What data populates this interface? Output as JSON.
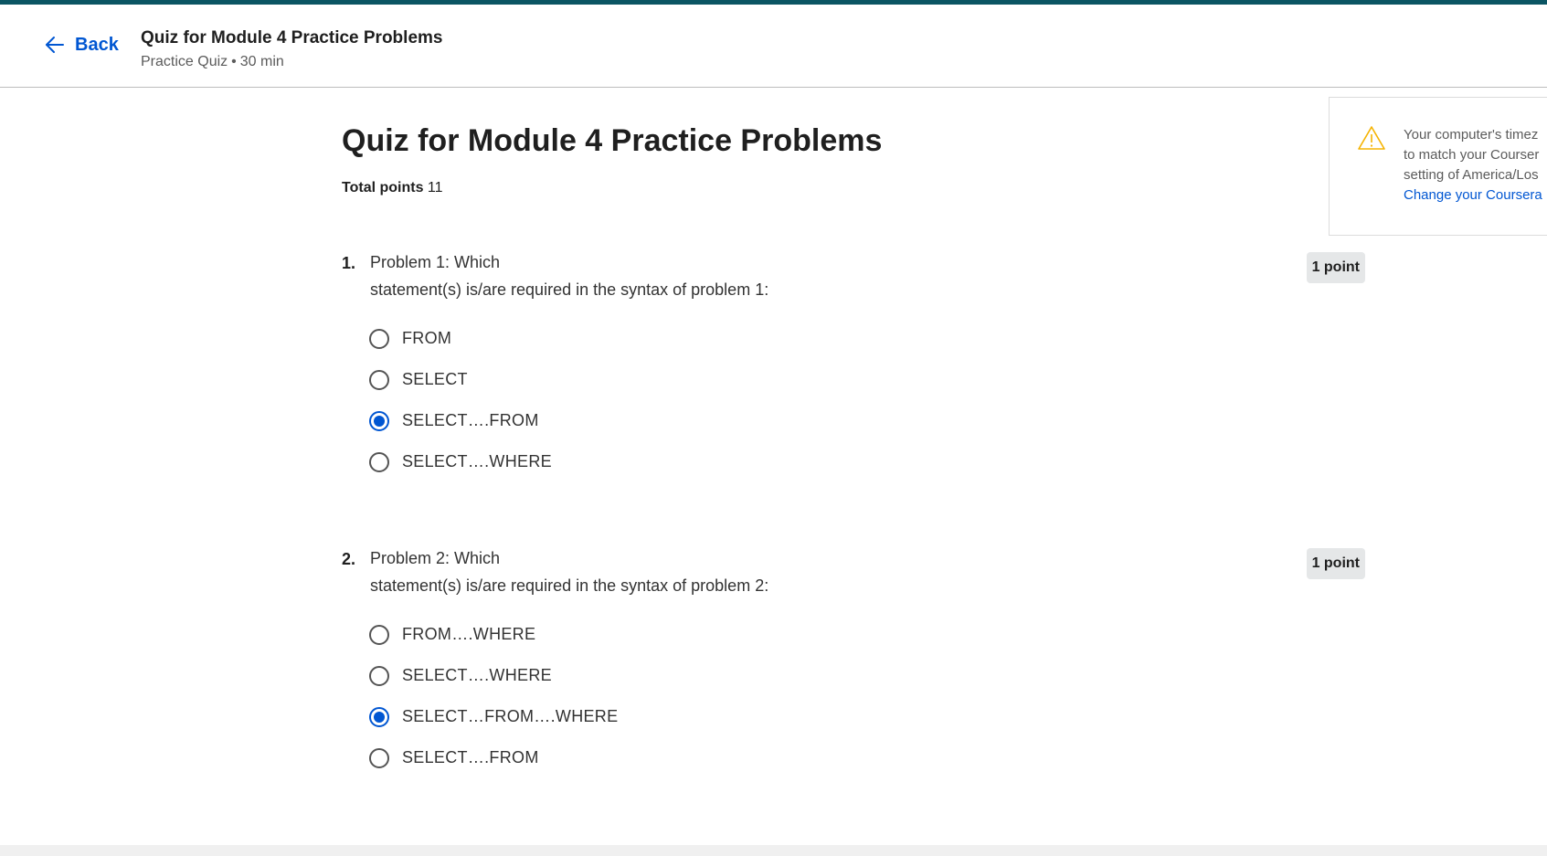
{
  "header": {
    "back_label": "Back",
    "title": "Quiz for Module 4 Practice Problems",
    "subtitle_type": "Practice Quiz",
    "subtitle_sep": "•",
    "subtitle_duration": "30 min"
  },
  "main": {
    "title": "Quiz for Module 4 Practice Problems",
    "total_points_label": "Total points",
    "total_points_value": "11"
  },
  "notice": {
    "line1": "Your computer's timez",
    "line2": "to match your Courser",
    "line3": "setting of America/Los",
    "link": "Change your Coursera"
  },
  "questions": [
    {
      "number": "1.",
      "text_line1": "Problem 1: Which",
      "text_line2": "statement(s) is/are required in the syntax of problem 1:",
      "points": "1 point",
      "options": [
        "FROM",
        "SELECT",
        "SELECT….FROM",
        "SELECT….WHERE"
      ],
      "selected_index": 2
    },
    {
      "number": "2.",
      "text_line1": "Problem 2: Which",
      "text_line2": "statement(s) is/are required in the syntax of problem 2:",
      "points": "1 point",
      "options": [
        "FROM….WHERE",
        "SELECT….WHERE",
        "SELECT…FROM….WHERE",
        "SELECT….FROM"
      ],
      "selected_index": 2
    }
  ],
  "colors": {
    "accent_bar": "#0b5563",
    "link_blue": "#0056d2",
    "warning_icon": "#f5b301"
  },
  "icons": {
    "back": "arrow-left-icon",
    "notice": "warning-triangle-icon"
  }
}
